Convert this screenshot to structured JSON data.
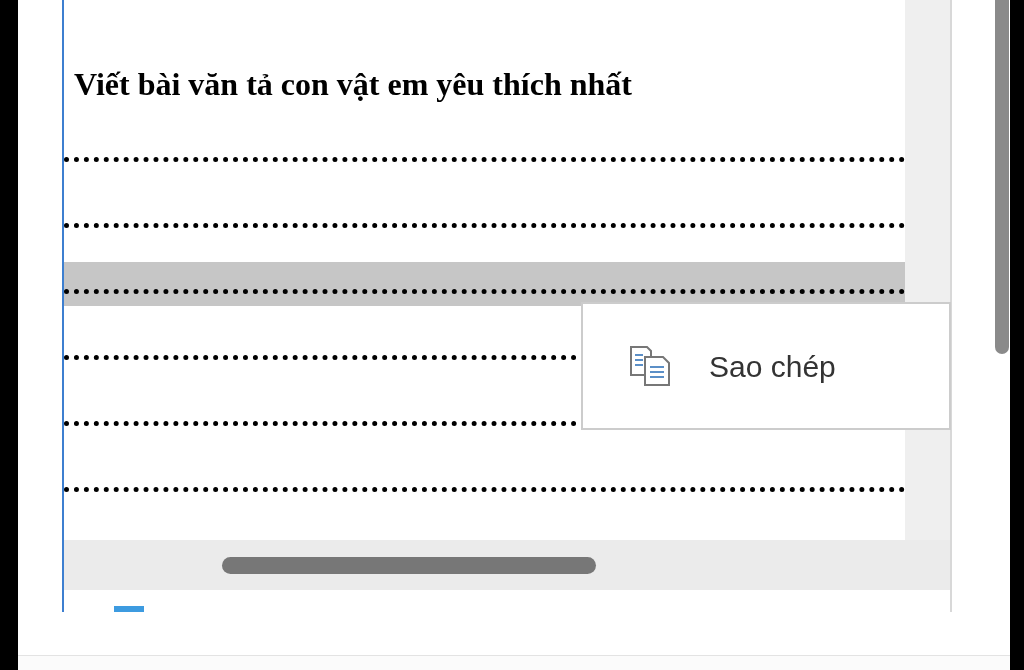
{
  "document": {
    "heading": "Viết bài văn tả con vật em yêu thích nhất",
    "lines": [
      {
        "selected": false
      },
      {
        "selected": false
      },
      {
        "selected": true
      },
      {
        "selected": false
      },
      {
        "selected": false
      },
      {
        "selected": false
      }
    ]
  },
  "context_menu": {
    "items": [
      {
        "label": "Sao chép"
      }
    ]
  }
}
